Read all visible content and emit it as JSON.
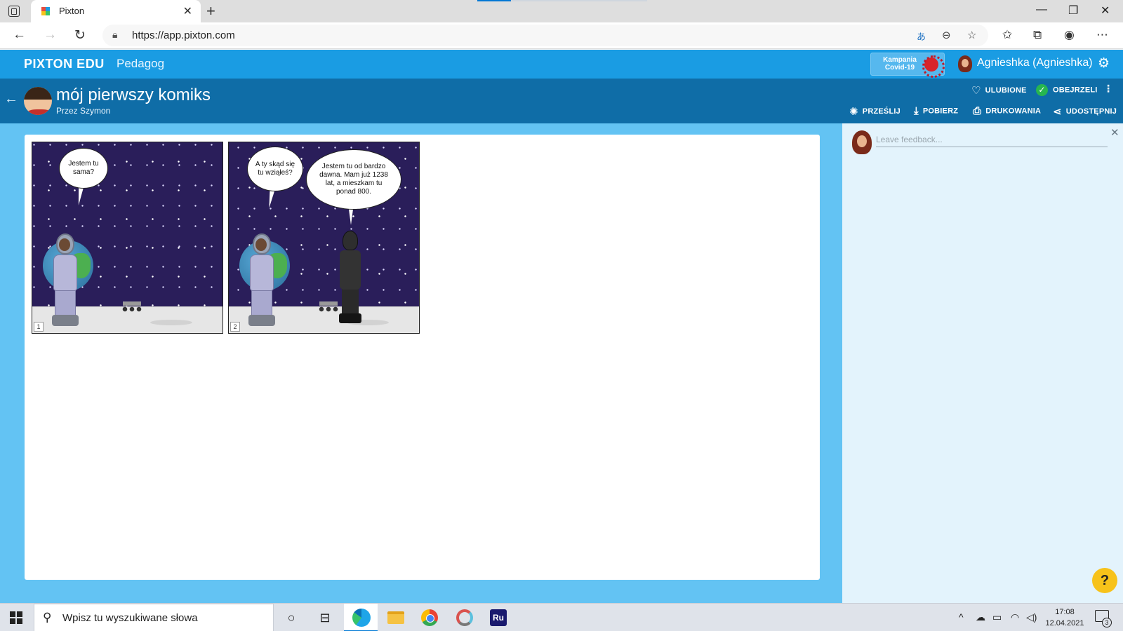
{
  "browser": {
    "tab_title": "Pixton",
    "url": "https://app.pixton.com"
  },
  "app": {
    "brand": "PIXTON EDU",
    "role": "Pedagog",
    "campaign": "Kampania Covid-19",
    "user_name": "Agnieshka (Agnieshka)"
  },
  "comic": {
    "title": "mój pierwszy komiks",
    "author": "Przez Szymon",
    "actions": {
      "favorite": "ULUBIONE",
      "viewed": "OBEJRZELI",
      "send": "PRZEŚLIJ",
      "download": "POBIERZ",
      "print": "DRUKOWANIA",
      "share": "UDOSTĘPNIJ"
    },
    "panels": [
      {
        "number": "1",
        "bubbles": [
          "Jestem tu sama?"
        ]
      },
      {
        "number": "2",
        "bubbles": [
          "A ty skąd się tu wziąłeś?",
          "Jestem tu od bardzo dawna. Mam już 1238 lat, a mieszkam tu ponad 800."
        ]
      }
    ]
  },
  "feedback": {
    "placeholder": "Leave feedback..."
  },
  "help": "?",
  "taskbar": {
    "search_placeholder": "Wpisz tu wyszukiwane słowa",
    "ru_label": "Ru",
    "time": "17:08",
    "date": "12.04.2021",
    "notifications": "3"
  },
  "colors": {
    "header_blue": "#1a9ce3",
    "title_bar_blue": "#0f6da7",
    "content_blue": "#63c3f3",
    "help_yellow": "#f7c21a"
  }
}
